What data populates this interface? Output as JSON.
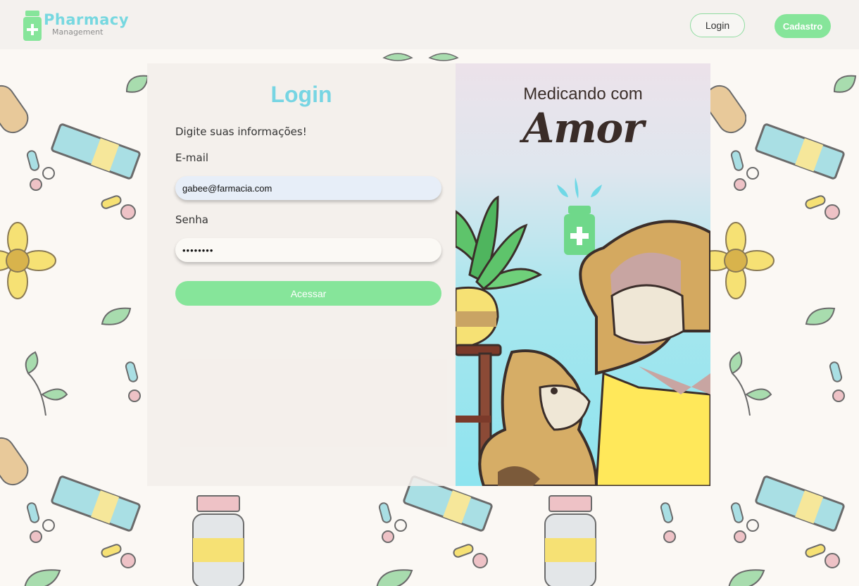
{
  "header": {
    "logo_main": "Pharmacy",
    "logo_sub": "Management",
    "login_label": "Login",
    "signup_label": "Cadastro"
  },
  "form": {
    "title": "Login",
    "subtitle": "Digite suas informações!",
    "email_label": "E-mail",
    "email_value": "gabee@farmacia.com",
    "password_label": "Senha",
    "password_value": "••••••••",
    "submit_label": "Acessar"
  },
  "illustration": {
    "headline": "Medicando com",
    "script": "Amor"
  },
  "colors": {
    "accent_green": "#86e59a",
    "accent_cyan": "#77d5e3"
  }
}
